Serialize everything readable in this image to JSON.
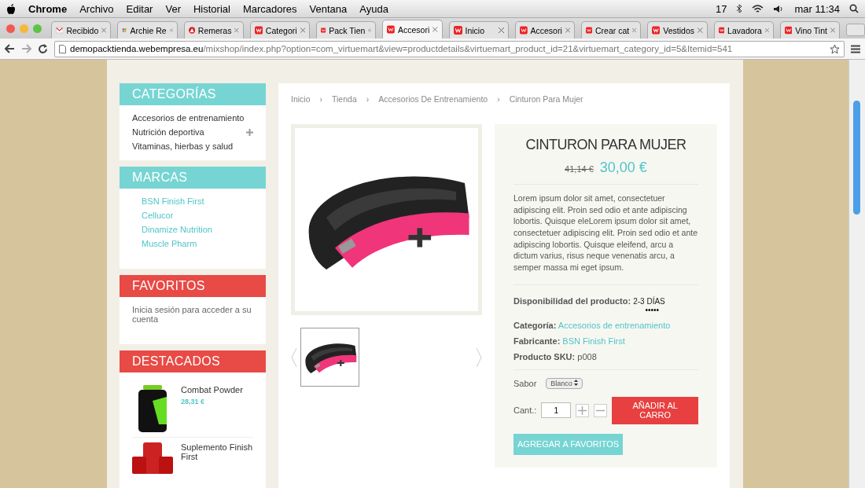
{
  "menubar": {
    "app": "Chrome",
    "menus": [
      "Archivo",
      "Editar",
      "Ver",
      "Historial",
      "Marcadores",
      "Ventana",
      "Ayuda"
    ],
    "badge": "17",
    "clock": "mar 11:34"
  },
  "tabs": [
    {
      "label": "Recibido",
      "kind": "mail",
      "selected": false
    },
    {
      "label": "Archie Re",
      "kind": "joomla",
      "selected": false
    },
    {
      "label": "Remeras",
      "kind": "circle",
      "selected": false
    },
    {
      "label": "Categori",
      "kind": "w",
      "selected": false
    },
    {
      "label": "Pack Tien",
      "kind": "w",
      "selected": false
    },
    {
      "label": "Accesori",
      "kind": "w",
      "selected": true
    },
    {
      "label": "Inicio",
      "kind": "w",
      "selected": false
    },
    {
      "label": "Accesori",
      "kind": "w",
      "selected": false
    },
    {
      "label": "Crear cat",
      "kind": "w",
      "selected": false
    },
    {
      "label": "Vestidos",
      "kind": "w",
      "selected": false
    },
    {
      "label": "Lavadora",
      "kind": "w",
      "selected": false
    },
    {
      "label": "Vino Tint",
      "kind": "w",
      "selected": false
    }
  ],
  "address_bar": {
    "host": "demopacktienda.webempresa.eu",
    "path": "/mixshop/index.php?option=com_virtuemart&view=productdetails&virtuemart_product_id=21&virtuemart_category_id=5&Itemid=541"
  },
  "sidebar": [
    {
      "title": "CATEGORÍAS",
      "kind": "categories",
      "color": "#76d5d3",
      "items": [
        {
          "label": "Accesorios de entrenamiento",
          "expandable": false
        },
        {
          "label": "Nutrición deportiva",
          "expandable": true
        },
        {
          "label": "Vitaminas, hierbas y salud",
          "expandable": false
        }
      ]
    },
    {
      "title": "MARCAS",
      "kind": "links",
      "color": "#76d5d3",
      "items": [
        {
          "label": "BSN Finish First"
        },
        {
          "label": "Cellucor"
        },
        {
          "label": "Dinamize Nutrition"
        },
        {
          "label": "Muscle Pharm"
        }
      ]
    },
    {
      "title": "FAVORITOS",
      "kind": "text",
      "color": "#e84a45",
      "text": "Inicia sesión para acceder a su cuenta"
    },
    {
      "title": "DESTACADOS",
      "kind": "products",
      "color": "#e84a45",
      "items": [
        {
          "name": "Combat Powder",
          "price": "28,31 €"
        },
        {
          "name": "Suplemento Finish First"
        }
      ]
    }
  ],
  "breadcrumb": {
    "separator": "›",
    "items": [
      "Inicio",
      "Tienda",
      "Accesorios De Entrenamiento",
      "Cinturon Para Mujer"
    ]
  },
  "product": {
    "title": "CINTURON PARA MUJER",
    "old_price": "41,14 €",
    "price": "30,00 €",
    "description": "Lorem ipsum dolor sit amet, consectetuer adipiscing elit. Proin sed odio et ante adipiscing lobortis. Quisque eleLorem ipsum dolor sit amet, consectetuer adipiscing elit. Proin sed odio et ante adipiscing lobortis. Quisque eleifend, arcu a dictum varius, risus neque venenatis arcu, a semper massa mi eget ipsum.",
    "availability": {
      "label": "Disponibilidad del producto:",
      "value": "2-3 DÍAS",
      "dots": "•••••"
    },
    "details": [
      {
        "label": "Categoría:",
        "value": "Accesorios de entrenamiento",
        "link": true
      },
      {
        "label": "Fabricante:",
        "value": "BSN Finish First",
        "link": true
      },
      {
        "label": "Producto SKU:",
        "value": "p008",
        "link": false
      }
    ],
    "variant": {
      "label": "Sabor",
      "value": "Blanco"
    },
    "quantity": {
      "label": "Cant.:",
      "value": "1"
    },
    "add_to_cart": "AÑADIR AL CARRO",
    "add_to_favorites": "AGREGAR A FAVORITOS"
  }
}
